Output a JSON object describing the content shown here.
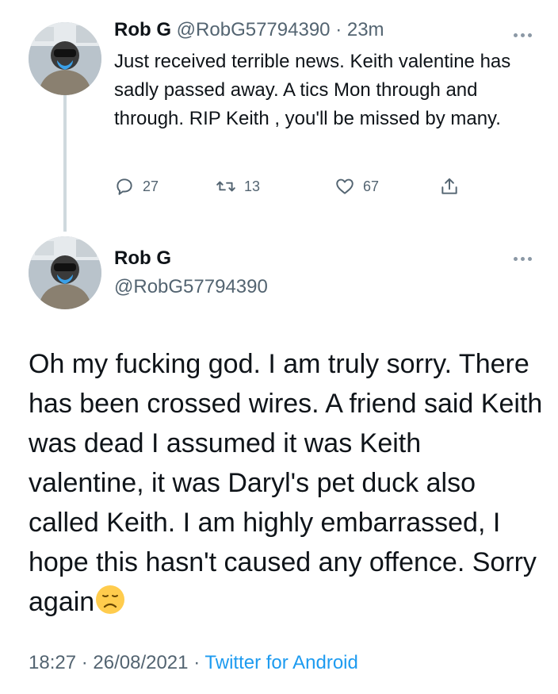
{
  "parent_tweet": {
    "name": "Rob G",
    "handle": "@RobG57794390",
    "separator": "·",
    "time": "23m",
    "text": "Just received terrible news. Keith valentine has sadly passed away. A tics Mon through and through. RIP Keith , you'll be missed by many.",
    "replies": "27",
    "retweets": "13",
    "likes": "67"
  },
  "main_tweet": {
    "name": "Rob G",
    "handle": "@RobG57794390",
    "text": "Oh my fucking god. I am truly sorry. There has been crossed wires.  A friend said Keith was dead I assumed it was Keith valentine, it was Daryl's pet duck also called Keith. I am highly embarrassed, I hope this hasn't caused any offence. Sorry again",
    "emoji": "disappointed-face",
    "timestamp": "18:27 · 26/08/2021",
    "separator": "·",
    "source": "Twitter for Android"
  },
  "colors": {
    "text_primary": "#0f1419",
    "text_secondary": "#536471",
    "link_blue": "#1d9bf0",
    "thread_line": "#cfd9de"
  }
}
